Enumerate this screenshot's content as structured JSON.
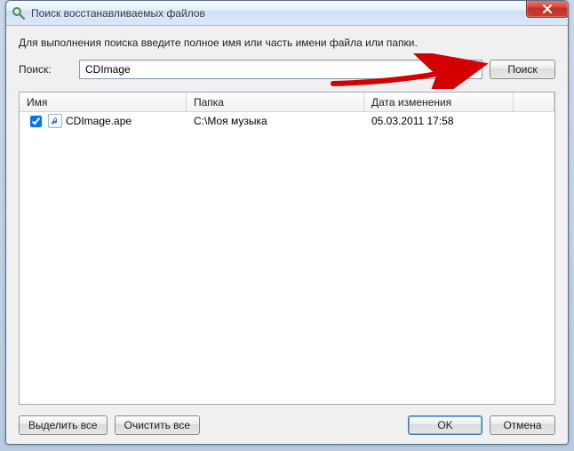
{
  "window": {
    "title": "Поиск восстанавливаемых файлов"
  },
  "instruction": "Для выполнения поиска введите полное имя или часть имени файла или папки.",
  "search": {
    "label": "Поиск:",
    "value": "CDImage",
    "button": "Поиск"
  },
  "columns": {
    "name": "Имя",
    "folder": "Папка",
    "date": "Дата изменения"
  },
  "rows": [
    {
      "checked": true,
      "name": "CDImage.ape",
      "folder": "C:\\Моя музыка",
      "date": "05.03.2011 17:58"
    }
  ],
  "footer": {
    "select_all": "Выделить все",
    "clear_all": "Очистить все",
    "ok": "OK",
    "cancel": "Отмена"
  },
  "colors": {
    "close_button": "#c9362a",
    "titlebar_top": "#e8f2fc",
    "arrow": "#d40000"
  }
}
